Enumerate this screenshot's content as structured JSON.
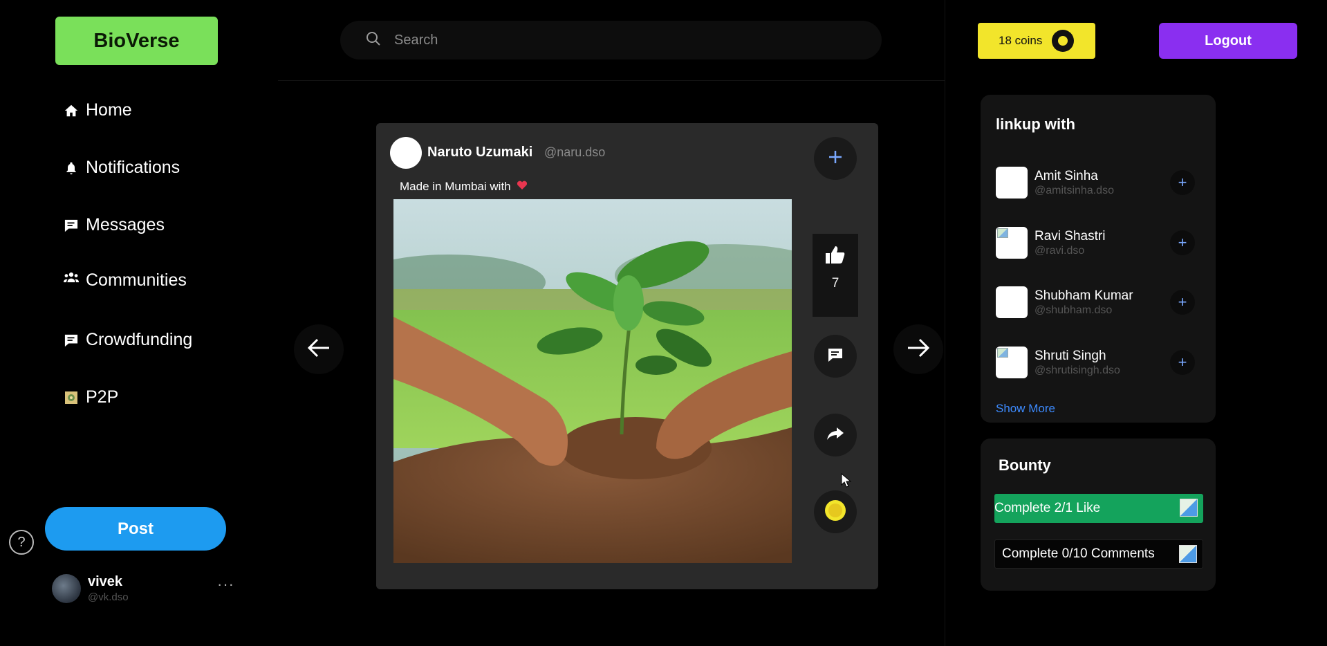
{
  "app": {
    "name": "BioVerse"
  },
  "sidebar": {
    "items": [
      {
        "label": "Home",
        "icon": "home-icon"
      },
      {
        "label": "Notifications",
        "icon": "bell-icon"
      },
      {
        "label": "Messages",
        "icon": "message-icon"
      },
      {
        "label": "Communities",
        "icon": "users-icon"
      },
      {
        "label": "Crowdfunding",
        "icon": "message-icon"
      },
      {
        "label": "P2P",
        "icon": "image-icon"
      }
    ],
    "post_label": "Post",
    "help_label": "?",
    "user": {
      "name": "vivek",
      "handle": "@vk.dso",
      "more": "···"
    }
  },
  "search": {
    "placeholder": "Search"
  },
  "post": {
    "author": "Naruto Uzumaki",
    "handle": "@naru.dso",
    "caption": "Made in Mumbai with",
    "likes": "7"
  },
  "header": {
    "coins_label": "18 coins",
    "logout_label": "Logout"
  },
  "linkup": {
    "title": "linkup with",
    "users": [
      {
        "name": "Amit Sinha",
        "handle": "@amitsinha.dso"
      },
      {
        "name": "Ravi Shastri",
        "handle": "@ravi.dso"
      },
      {
        "name": "Shubham Kumar",
        "handle": "@shubham.dso"
      },
      {
        "name": "Shruti Singh",
        "handle": "@shrutisingh.dso"
      }
    ],
    "show_more": "Show More",
    "add_symbol": "+"
  },
  "bounty": {
    "title": "Bounty",
    "tasks": [
      {
        "label": "Complete 2/1 Like",
        "status": "complete"
      },
      {
        "label": "Complete 0/10 Comments",
        "status": "pending"
      }
    ]
  },
  "colors": {
    "logo_bg": "#7ae05a",
    "post_button": "#1d9bf0",
    "logout_button": "#8a2ff0",
    "coins_bg": "#f2e52b",
    "bounty_done": "#14a35c",
    "show_more_link": "#3d8bff",
    "heart": "#e8364f"
  }
}
